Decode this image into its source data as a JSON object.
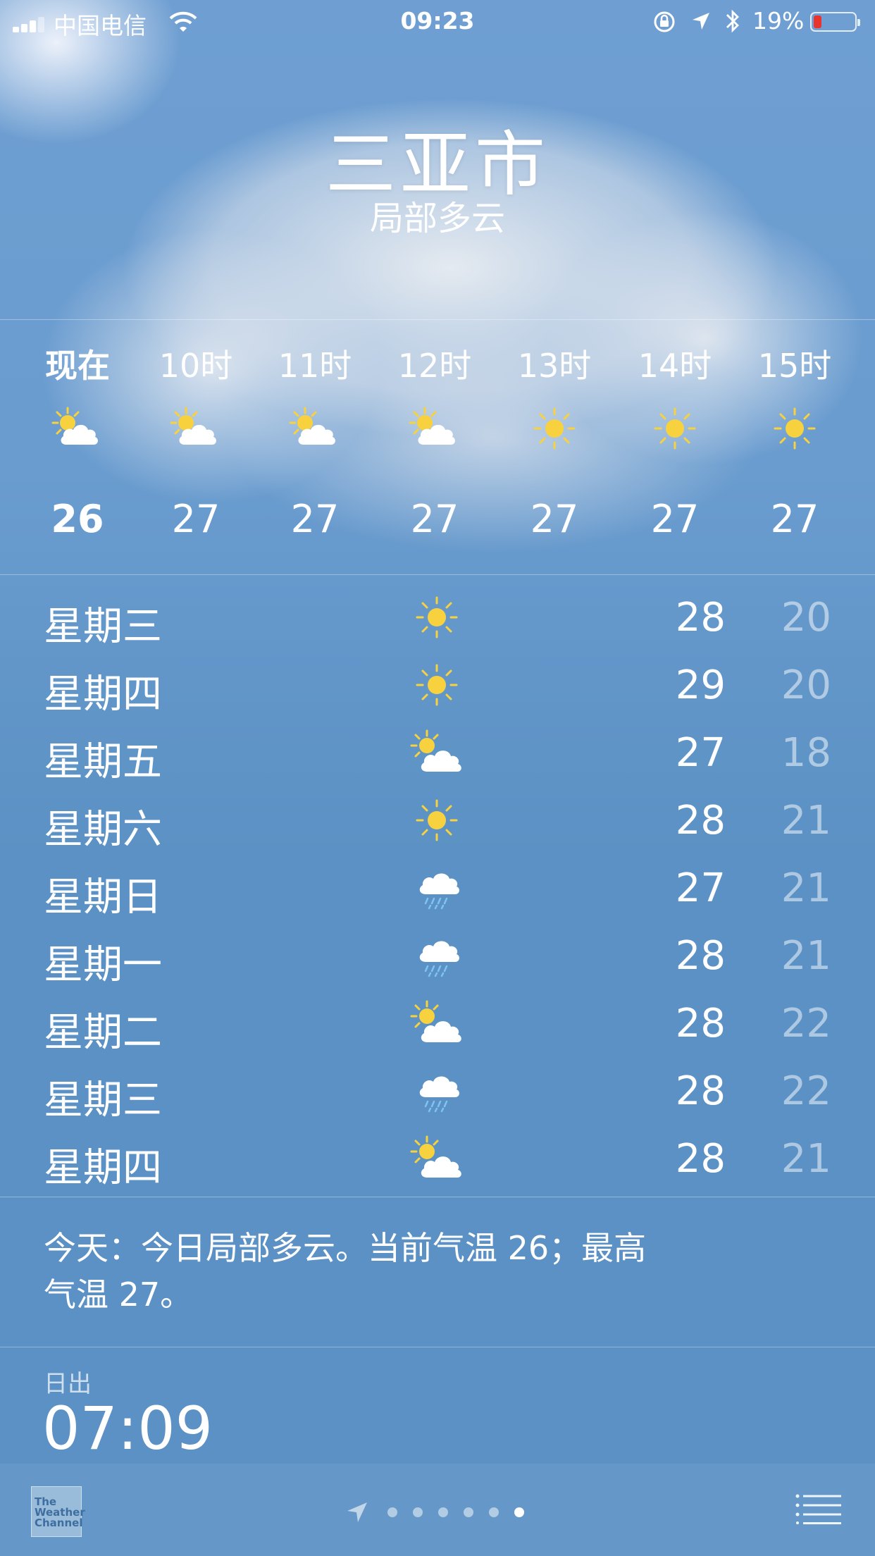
{
  "status_bar": {
    "carrier": "中国电信",
    "time": "09:23",
    "battery_percent": "19%",
    "battery_level": 0.19,
    "battery_color": "#e8342c"
  },
  "header": {
    "city": "三亚市",
    "condition": "局部多云"
  },
  "hourly": [
    {
      "time": "现在",
      "icon": "partly-cloudy-icon",
      "temp": "26"
    },
    {
      "time": "10时",
      "icon": "partly-cloudy-icon",
      "temp": "27"
    },
    {
      "time": "11时",
      "icon": "partly-cloudy-icon",
      "temp": "27"
    },
    {
      "time": "12时",
      "icon": "partly-cloudy-icon",
      "temp": "27"
    },
    {
      "time": "13时",
      "icon": "sun-icon",
      "temp": "27"
    },
    {
      "time": "14时",
      "icon": "sun-icon",
      "temp": "27"
    },
    {
      "time": "15时",
      "icon": "sun-icon",
      "temp": "27"
    }
  ],
  "daily": [
    {
      "day": "星期三",
      "icon": "sun-icon",
      "high": "28",
      "low": "20"
    },
    {
      "day": "星期四",
      "icon": "sun-icon",
      "high": "29",
      "low": "20"
    },
    {
      "day": "星期五",
      "icon": "partly-cloudy-icon",
      "high": "27",
      "low": "18"
    },
    {
      "day": "星期六",
      "icon": "sun-icon",
      "high": "28",
      "low": "21"
    },
    {
      "day": "星期日",
      "icon": "rain-icon",
      "high": "27",
      "low": "21"
    },
    {
      "day": "星期一",
      "icon": "rain-icon",
      "high": "28",
      "low": "21"
    },
    {
      "day": "星期二",
      "icon": "partly-cloudy-icon",
      "high": "28",
      "low": "22"
    },
    {
      "day": "星期三",
      "icon": "rain-icon",
      "high": "28",
      "low": "22"
    },
    {
      "day": "星期四",
      "icon": "partly-cloudy-icon",
      "high": "28",
      "low": "21"
    }
  ],
  "summary": {
    "line1": "今天：今日局部多云。当前气温 26；最高",
    "line2": "气温 27。"
  },
  "details": {
    "sunrise_label": "日出",
    "sunrise_value": "07:09"
  },
  "toolbar": {
    "logo_text": "The Weather Channel",
    "page_count": 6,
    "active_page": 6
  },
  "colors": {
    "sun": "#f7d23e",
    "rain": "#7fc3f2",
    "sky": "#5b91c4"
  }
}
